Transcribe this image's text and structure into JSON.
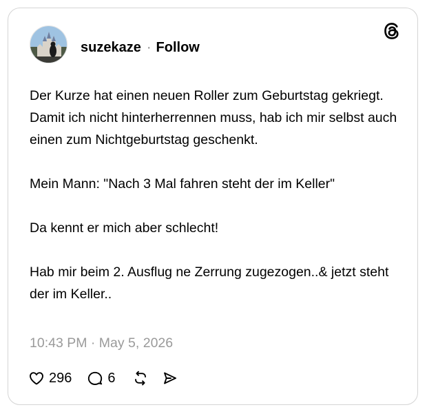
{
  "post": {
    "username": "suzekaze",
    "separator": "·",
    "follow_label": "Follow",
    "body": [
      "Der Kurze hat einen neuen Roller zum Geburtstag gekriegt.",
      "Damit ich nicht hinterherrennen muss, hab ich mir selbst auch einen zum Nichtgeburtstag geschenkt.",
      "",
      "Mein Mann: \"Nach 3 Mal fahren steht der im Keller\"",
      "",
      "Da kennt er mich aber schlecht!",
      "",
      "Hab mir beim 2. Ausflug ne Zerrung zugezogen..& jetzt steht der im Keller.."
    ],
    "timestamp": "10:43 PM · May 5, 2026"
  },
  "actions": {
    "like_count": "296",
    "reply_count": "6",
    "like_icon": "heart-icon",
    "reply_icon": "speech-bubble-icon",
    "repost_icon": "repost-arrows-icon",
    "share_icon": "send-arrow-icon"
  },
  "icons": {
    "brand": "threads-logo-icon"
  },
  "colors": {
    "text": "#000000",
    "muted": "#9a9a9a",
    "border": "#d4d4d4"
  }
}
